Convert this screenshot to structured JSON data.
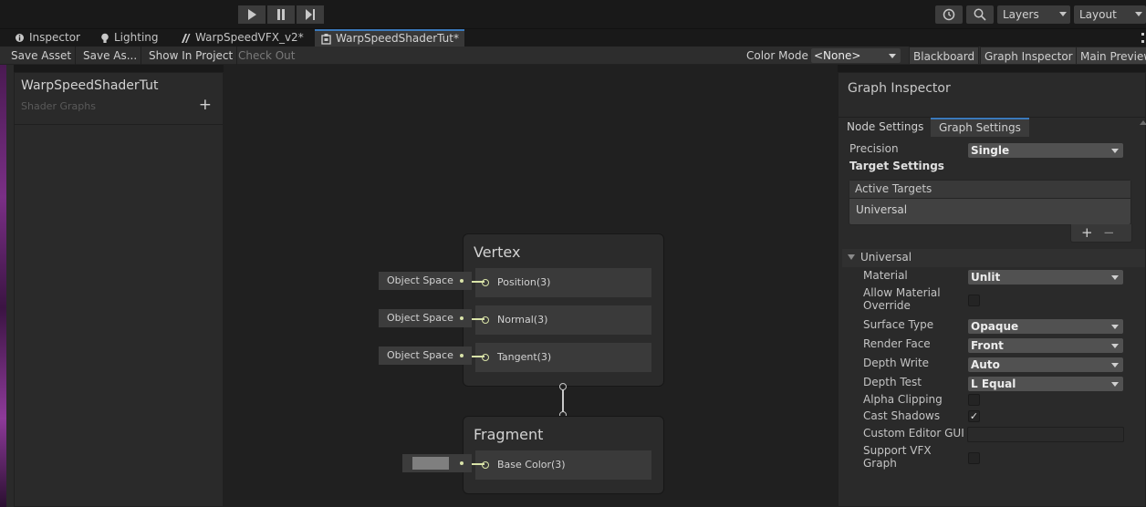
{
  "toolbar": {
    "layers_label": "Layers",
    "layout_label": "Layout"
  },
  "tabs": [
    {
      "label": "Inspector"
    },
    {
      "label": "Lighting"
    },
    {
      "label": "WarpSpeedVFX_v2*"
    },
    {
      "label": "WarpSpeedShaderTut*"
    }
  ],
  "actions": {
    "save_asset": "Save Asset",
    "save_as": "Save As...",
    "show_in_project": "Show In Project",
    "check_out": "Check Out",
    "color_mode_label": "Color Mode",
    "color_mode_value": "<None>",
    "blackboard": "Blackboard",
    "graph_inspector": "Graph Inspector",
    "main_preview": "Main Preview"
  },
  "blackboard": {
    "title": "WarpSpeedShaderTut",
    "subtitle": "Shader Graphs",
    "add": "+"
  },
  "graph": {
    "vertex": {
      "title": "Vertex",
      "slots": [
        {
          "label": "Position(3)",
          "input": "Object Space"
        },
        {
          "label": "Normal(3)",
          "input": "Object Space"
        },
        {
          "label": "Tangent(3)",
          "input": "Object Space"
        }
      ]
    },
    "fragment": {
      "title": "Fragment",
      "slots": [
        {
          "label": "Base Color(3)",
          "swatch_color": "#7f7f7f"
        }
      ]
    }
  },
  "inspector": {
    "title": "Graph Inspector",
    "tabs": {
      "node_settings": "Node Settings",
      "graph_settings": "Graph Settings"
    },
    "precision_label": "Precision",
    "precision_value": "Single",
    "target_settings": "Target Settings",
    "active_targets": "Active Targets",
    "active_target_item": "Universal",
    "plus": "+",
    "minus": "−",
    "universal_section": "Universal",
    "props": {
      "material": {
        "label": "Material",
        "value": "Unlit"
      },
      "allow_override": {
        "label": "Allow Material Override",
        "checked": false
      },
      "surface_type": {
        "label": "Surface Type",
        "value": "Opaque"
      },
      "render_face": {
        "label": "Render Face",
        "value": "Front"
      },
      "depth_write": {
        "label": "Depth Write",
        "value": "Auto"
      },
      "depth_test": {
        "label": "Depth Test",
        "value": "L Equal"
      },
      "alpha_clipping": {
        "label": "Alpha Clipping",
        "checked": false
      },
      "cast_shadows": {
        "label": "Cast Shadows",
        "checked": true,
        "mark": "✓"
      },
      "custom_editor_gui": {
        "label": "Custom Editor GUI",
        "value": ""
      },
      "support_vfx": {
        "label": "Support VFX Graph",
        "checked": false
      }
    }
  },
  "colors": {
    "accent_blue": "#3a79bb",
    "port_yellow": "#d9e3a8",
    "canvas_bg": "#202020"
  }
}
